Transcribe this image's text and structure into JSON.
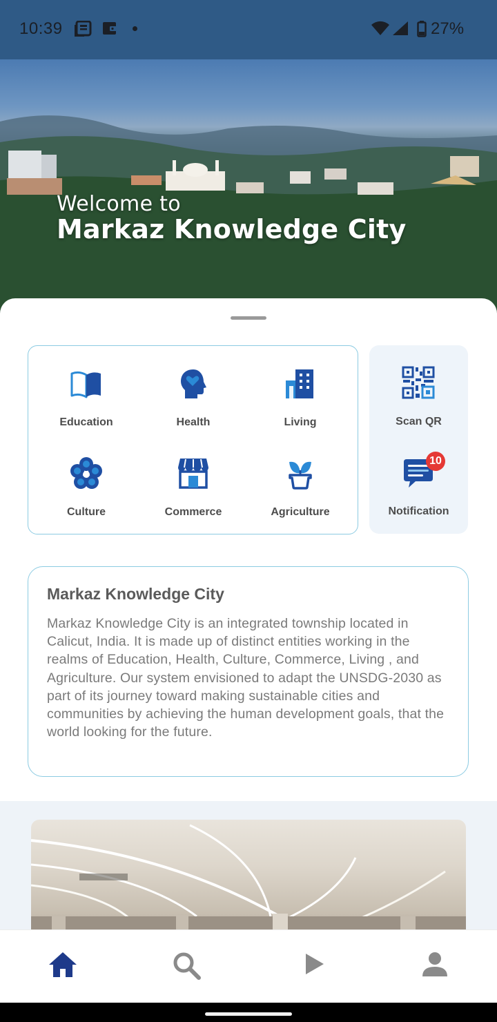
{
  "status_bar": {
    "time": "10:39",
    "battery": "27%",
    "icons": [
      "news-icon",
      "wallet-icon",
      "dot-icon",
      "wifi-icon",
      "signal-icon",
      "battery-icon"
    ]
  },
  "hero": {
    "welcome": "Welcome to",
    "title": "Markaz Knowledge City"
  },
  "categories": [
    {
      "label": "Education",
      "icon": "book-icon"
    },
    {
      "label": "Health",
      "icon": "head-heart-icon"
    },
    {
      "label": "Living",
      "icon": "building-icon"
    },
    {
      "label": "Culture",
      "icon": "flower-icon"
    },
    {
      "label": "Commerce",
      "icon": "store-icon"
    },
    {
      "label": "Agriculture",
      "icon": "plant-icon"
    }
  ],
  "quick_actions": [
    {
      "label": "Scan QR",
      "icon": "qr-code-icon"
    },
    {
      "label": "Notification",
      "icon": "message-icon",
      "badge": "10"
    }
  ],
  "about": {
    "title": "Markaz Knowledge City",
    "body": "Markaz Knowledge City is an integrated township located in Calicut, India. It is made up of distinct entities working in the realms of Education, Health, Culture, Commerce, Living , and Agriculture. Our system envisioned to adapt the UNSDG-2030 as part of its journey toward making sustainable cities and communities by achieving the human development goals, that the world looking for the future."
  },
  "bottom_nav": [
    {
      "name": "home",
      "icon": "home-icon",
      "active": true
    },
    {
      "name": "search",
      "icon": "search-icon",
      "active": false
    },
    {
      "name": "play",
      "icon": "play-icon",
      "active": false
    },
    {
      "name": "profile",
      "icon": "person-icon",
      "active": false
    }
  ],
  "colors": {
    "primary": "#1e3a8a",
    "accent_icon": "#1f4fa3",
    "border": "#8ccbe2",
    "badge": "#e53935",
    "muted_text": "#7a7a7a",
    "inactive_nav": "#8a8a8a"
  }
}
